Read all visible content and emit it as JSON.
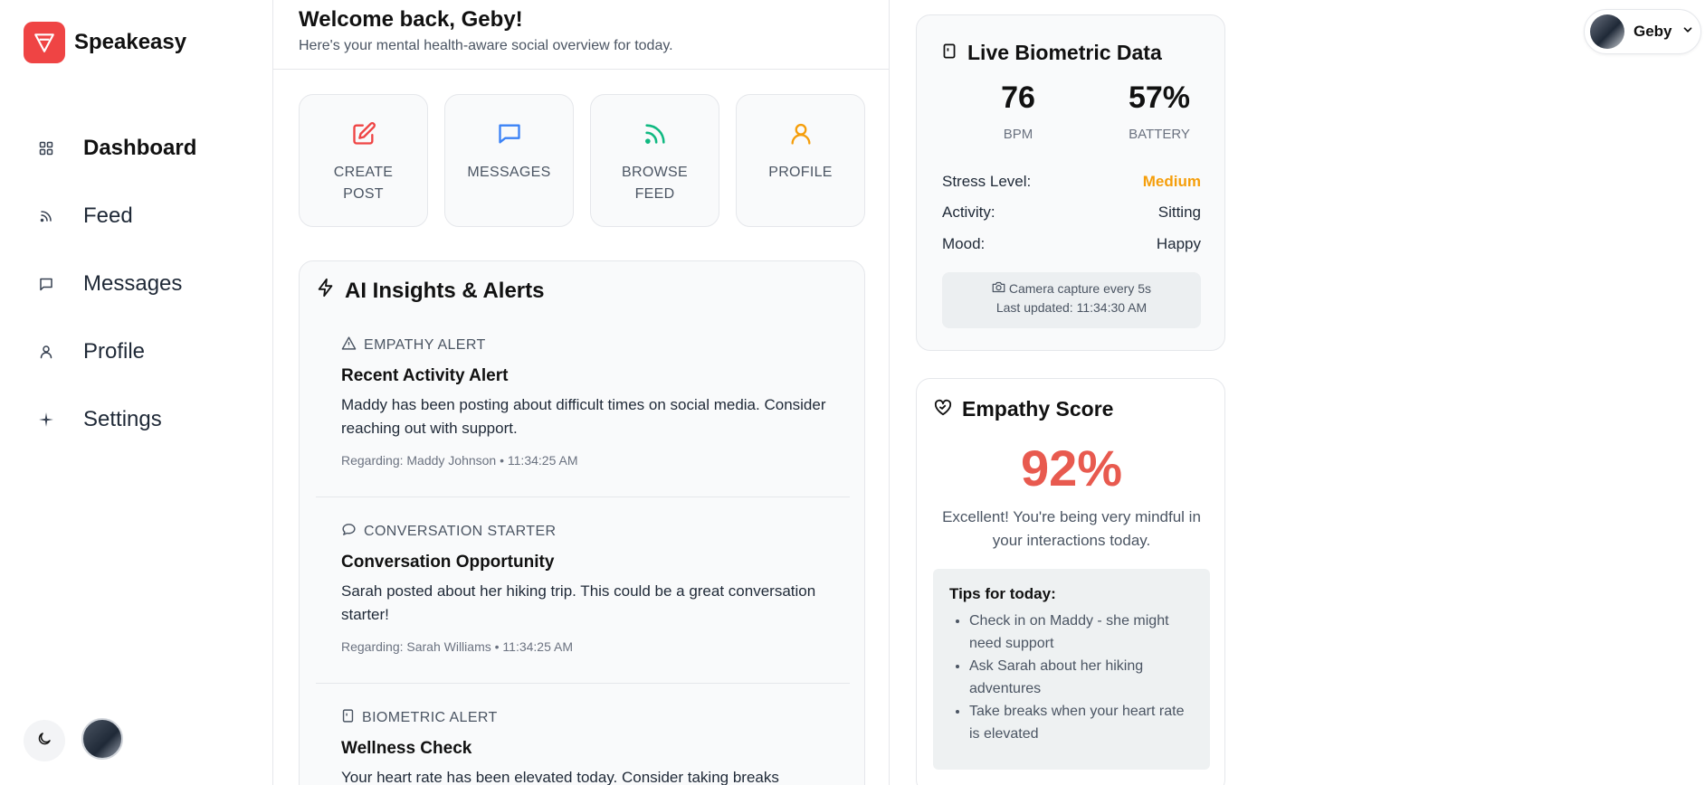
{
  "app": {
    "name": "Speakeasy",
    "brand_color": "#ef4444"
  },
  "sidebar": {
    "items": [
      {
        "label": "Dashboard",
        "icon": "grid-icon",
        "active": true
      },
      {
        "label": "Feed",
        "icon": "rss-icon",
        "active": false
      },
      {
        "label": "Messages",
        "icon": "message-icon",
        "active": false
      },
      {
        "label": "Profile",
        "icon": "user-icon",
        "active": false
      },
      {
        "label": "Settings",
        "icon": "sparkle-icon",
        "active": false
      }
    ],
    "theme_icon": "moon-icon"
  },
  "header": {
    "title": "Welcome back, Geby!",
    "subtitle": "Here's your mental health-aware social overview for today."
  },
  "actions": [
    {
      "label": "CREATE POST",
      "icon": "edit-icon",
      "color": "#ef4444"
    },
    {
      "label": "MESSAGES",
      "icon": "message-icon",
      "color": "#3b82f6"
    },
    {
      "label": "BROWSE FEED",
      "icon": "rss-icon",
      "color": "#10b981"
    },
    {
      "label": "PROFILE",
      "icon": "user-icon",
      "color": "#f59e0b"
    }
  ],
  "insights": {
    "title": "AI Insights & Alerts",
    "alerts": [
      {
        "type": "EMPATHY ALERT",
        "icon": "warning-icon",
        "title": "Recent Activity Alert",
        "body": "Maddy has been posting about difficult times on social media. Consider reaching out with support.",
        "meta": "Regarding: Maddy Johnson • 11:34:25 AM"
      },
      {
        "type": "CONVERSATION STARTER",
        "icon": "chat-bubble-icon",
        "title": "Conversation Opportunity",
        "body": "Sarah posted about her hiking trip. This could be a great conversation starter!",
        "meta": "Regarding: Sarah Williams • 11:34:25 AM"
      },
      {
        "type": "BIOMETRIC ALERT",
        "icon": "watch-icon",
        "title": "Wellness Check",
        "body": "Your heart rate has been elevated today. Consider taking breaks",
        "meta": ""
      }
    ]
  },
  "biometric": {
    "title": "Live Biometric Data",
    "bpm": "76",
    "bpm_label": "BPM",
    "battery": "57%",
    "battery_label": "BATTERY",
    "rows": [
      {
        "label": "Stress Level:",
        "value": "Medium"
      },
      {
        "label": "Activity:",
        "value": "Sitting"
      },
      {
        "label": "Mood:",
        "value": "Happy"
      }
    ],
    "camera_text": "Camera capture every 5s",
    "last_updated": "Last updated: 11:34:30 AM"
  },
  "empathy": {
    "title": "Empathy Score",
    "score": "92%",
    "message": "Excellent! You're being very mindful in your interactions today.",
    "tips_title": "Tips for today:",
    "tips": [
      "Check in on Maddy - she might need support",
      "Ask Sarah about her hiking adventures",
      "Take breaks when your heart rate is elevated"
    ]
  },
  "user": {
    "name": "Geby"
  }
}
